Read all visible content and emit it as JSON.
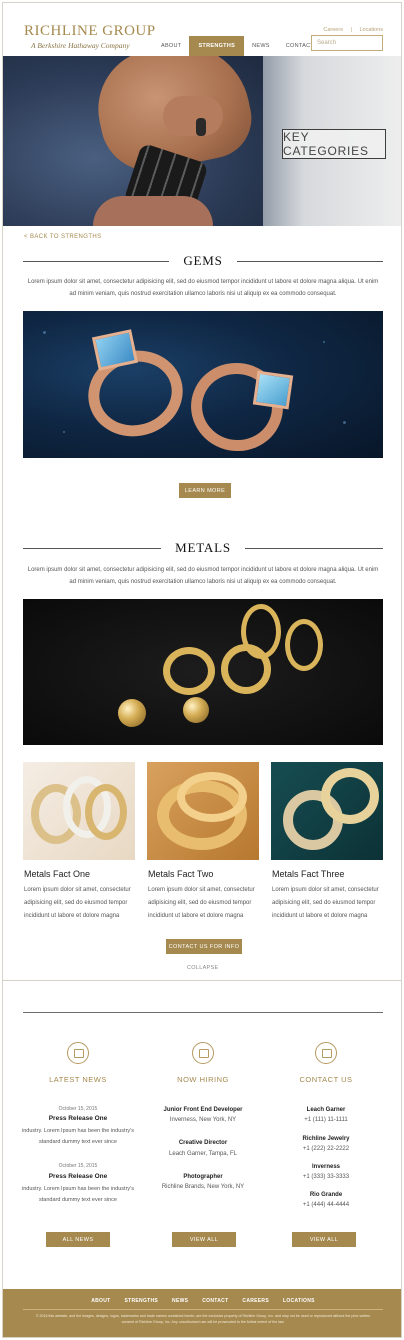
{
  "header": {
    "logo_title": "RICHLINE GROUP",
    "logo_subtitle": "A Berkshire Hathaway Company",
    "nav": [
      "ABOUT",
      "STRENGTHS",
      "NEWS",
      "CONTACT"
    ],
    "active_nav": "STRENGTHS",
    "util_links": [
      "Careers",
      "Locations"
    ],
    "search_placeholder": "Search"
  },
  "hero": {
    "label": "KEY CATEGORIES"
  },
  "back_link": "< BACK TO STRENGTHS",
  "gems": {
    "title": "GEMS",
    "text": "Lorem ipsum dolor sit amet, consectetur adipisicing elit, sed do eiusmod tempor incididunt ut labore et dolore magna aliqua. Ut enim ad minim veniam, quis nostrud exercitation ullamco laboris nisi ut aliquip ex ea commodo consequat.",
    "button": "LEARN MORE"
  },
  "metals": {
    "title": "METALS",
    "text": "Lorem ipsum dolor sit amet, consectetur adipisicing elit, sed do eiusmod tempor incididunt ut labore et dolore magna aliqua. Ut enim ad minim veniam, quis nostrud exercitation ullamco laboris nisi ut aliquip ex ea commodo consequat.",
    "facts": [
      {
        "title": "Metals Fact One",
        "text": "Lorem ipsum dolor sit amet, consectetur adipisicing elit, sed do eiusmod tempor incididunt ut labore et dolore magna"
      },
      {
        "title": "Metals Fact Two",
        "text": "Lorem ipsum dolor sit amet, consectetur adipisicing elit, sed do eiusmod tempor incididunt ut labore et dolore magna"
      },
      {
        "title": "Metals Fact Three",
        "text": "Lorem ipsum dolor sit amet, consectetur adipisicing elit, sed do eiusmod tempor incididunt ut labore et dolore magna"
      }
    ],
    "button": "CONTACT US FOR INFO",
    "collapse": "COLLAPSE"
  },
  "latest_news": {
    "heading": "LATEST NEWS",
    "items": [
      {
        "date": "October 15, 2015",
        "title": "Press Release One",
        "body": "industry. Lorem Ipsum has been the industry's standard dummy text ever since"
      },
      {
        "date": "October 15, 2015",
        "title": "Press Release One",
        "body": "industry. Lorem Ipsum has been the industry's standard dummy text ever since"
      }
    ],
    "button": "ALL NEWS"
  },
  "now_hiring": {
    "heading": "NOW HIRING",
    "items": [
      {
        "title": "Junior Front End Developer",
        "sub": "Inverness, New York, NY"
      },
      {
        "title": "Creative Director",
        "sub": "Leach Garner, Tampa, FL"
      },
      {
        "title": "Photographer",
        "sub": "Richline Brands, New York, NY"
      }
    ],
    "button": "VIEW ALL"
  },
  "contact_us": {
    "heading": "CONTACT US",
    "items": [
      {
        "title": "Leach Garner",
        "sub": "+1 (111) 11-1111"
      },
      {
        "title": "Richline Jewelry",
        "sub": "+1 (222) 22-2222"
      },
      {
        "title": "Inverness",
        "sub": "+1 (333) 33-3333"
      },
      {
        "title": "Rio Grande",
        "sub": "+1 (444) 44-4444"
      }
    ],
    "button": "VIEW ALL"
  },
  "footer": {
    "nav": [
      "ABOUT",
      "STRENGTHS",
      "NEWS",
      "CONTACT",
      "CAREERS",
      "LOCATIONS"
    ],
    "copyright": "© 2015 this website, and the images, designs, logos, trademarks and trade names contained herein, are the exclusive property of Richline Group, Inc. and may not be used or reproduced without the prior written consent of Richline Group, Inc. Any unauthorized use will be prosecuted to the fullest extent of the law."
  }
}
